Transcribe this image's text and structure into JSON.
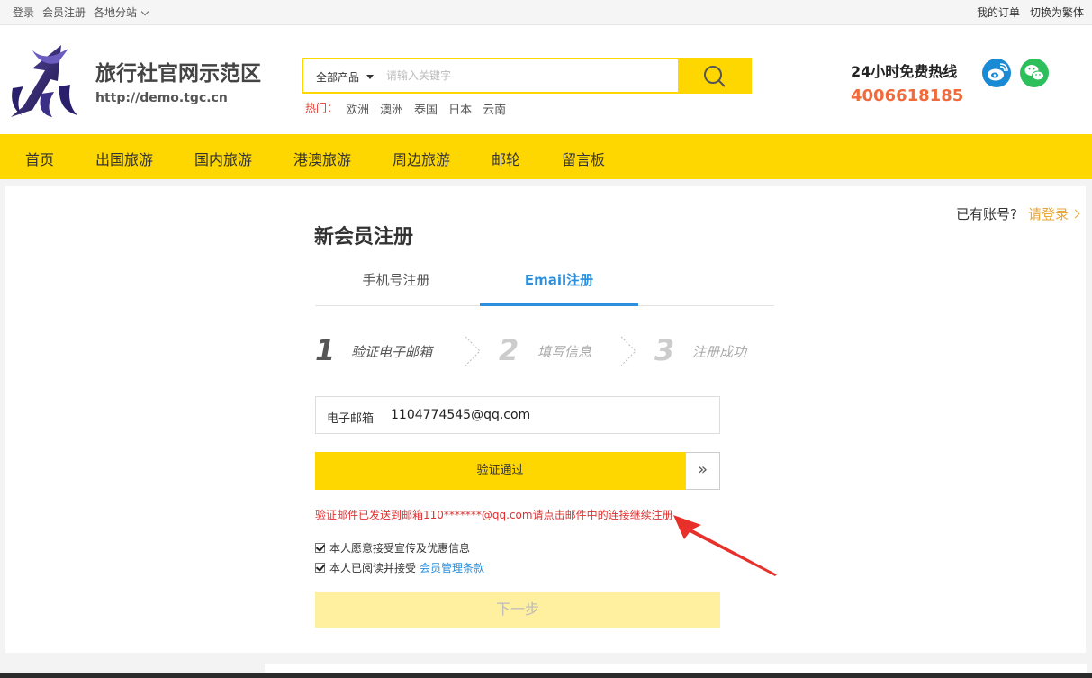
{
  "topbar": {
    "login": "登录",
    "register": "会员注册",
    "branches": "各地分站",
    "my_orders": "我的订单",
    "switch_traditional": "切换为繁体"
  },
  "header": {
    "site_title": "旅行社官网示范区",
    "site_url": "http://demo.tgc.cn",
    "hotline_title": "24小时免费热线",
    "hotline_number": "4006618185"
  },
  "search": {
    "category": "全部产品",
    "placeholder": "请输入关键字",
    "hot_label": "热门：",
    "hot_items": [
      "欧洲",
      "澳洲",
      "泰国",
      "日本",
      "云南"
    ]
  },
  "nav": {
    "items": [
      "首页",
      "出国旅游",
      "国内旅游",
      "港澳旅游",
      "周边旅游",
      "邮轮",
      "留言板"
    ]
  },
  "account": {
    "has_account": "已有账号?",
    "login_link": "请登录"
  },
  "register": {
    "title": "新会员注册",
    "tabs": [
      "手机号注册",
      "Email注册"
    ],
    "active_tab": "Email注册",
    "steps": [
      {
        "num": "1",
        "label": "验证电子邮箱"
      },
      {
        "num": "2",
        "label": "填写信息"
      },
      {
        "num": "3",
        "label": "注册成功"
      }
    ],
    "email_label": "电子邮箱",
    "email_value": "1104774545@qq.com",
    "verify_button": "验证通过",
    "verify_arrow": "»",
    "notice": "验证邮件已发送到邮箱110*******@qq.com请点击邮件中的连接继续注册",
    "checkbox_promo": "本人愿意接受宣传及优惠信息",
    "checkbox_terms": "本人已阅读并接受",
    "terms_link": "会员管理条款",
    "next_button": "下一步"
  },
  "colors": {
    "brand_yellow": "#ffd700",
    "accent_blue": "#2d8fdc",
    "hotline_orange": "#f06a3c",
    "notice_red": "#e03030"
  }
}
